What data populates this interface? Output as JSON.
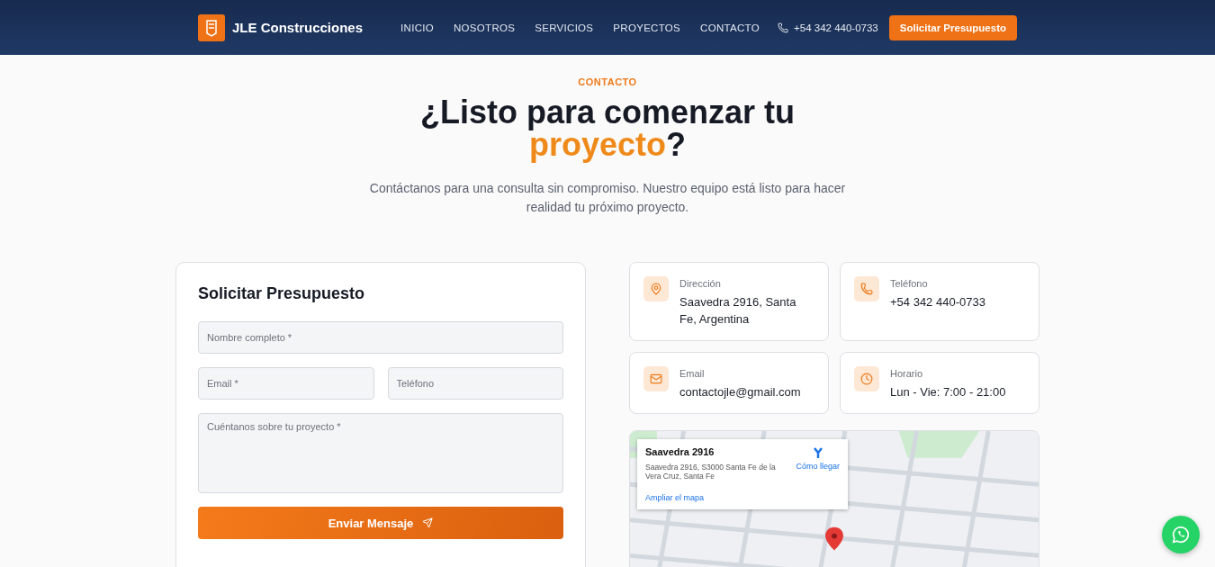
{
  "nav": {
    "brand": "JLE Construcciones",
    "links": [
      "INICIO",
      "NOSOTROS",
      "SERVICIOS",
      "PROYECTOS",
      "CONTACTO"
    ],
    "phone": "+54 342 440-0733",
    "cta": "Solicitar Presupuesto"
  },
  "hero": {
    "eyebrow": "CONTACTO",
    "title_before": "¿Listo para comenzar tu",
    "title_highlight": "proyecto",
    "title_after": "?",
    "subtitle": "Contáctanos para una consulta sin compromiso. Nuestro equipo está listo para hacer realidad tu próximo proyecto."
  },
  "form": {
    "title": "Solicitar Presupuesto",
    "rows": [
      [
        {
          "kind": "input",
          "placeholder": "Nombre completo *"
        }
      ],
      [
        {
          "kind": "input",
          "placeholder": "Email *"
        },
        {
          "kind": "input",
          "placeholder": "Teléfono"
        }
      ],
      [
        {
          "kind": "textarea",
          "placeholder": "Cuéntanos sobre tu proyecto *"
        }
      ]
    ],
    "submit": "Enviar Mensaje"
  },
  "info_cards": [
    {
      "kind": "location",
      "label": "Dirección",
      "value": "Saavedra 2916, Santa Fe, Argentina"
    },
    {
      "kind": "phone",
      "label": "Teléfono",
      "value": "+54 342 440-0733"
    },
    {
      "kind": "email",
      "label": "Email",
      "value": "contactojle@gmail.com"
    },
    {
      "kind": "hours",
      "label": "Horario",
      "value": "Lun - Vie: 7:00 - 21:00"
    }
  ],
  "map": {
    "place": "Saavedra 2916",
    "address": "Saavedra 2916, S3000 Santa Fe de la Vera Cruz, Santa Fe",
    "directions": "Cómo llegar",
    "enlarge": "Ampliar el mapa"
  }
}
